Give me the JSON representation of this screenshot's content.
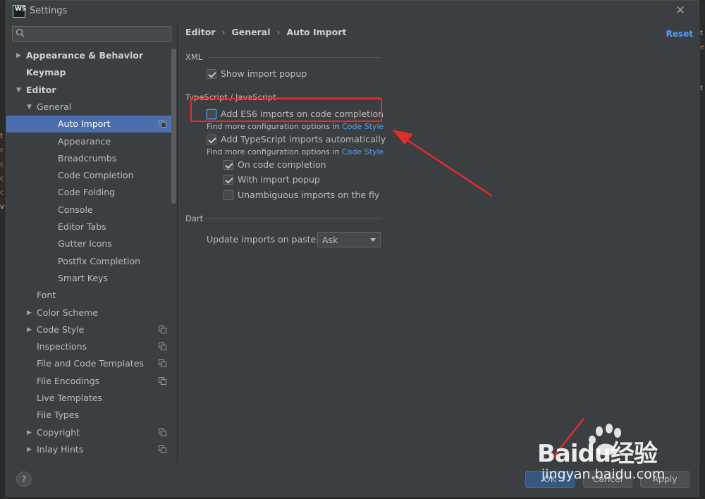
{
  "window": {
    "title": "Settings",
    "logo": "WS"
  },
  "search": {
    "placeholder": "",
    "value": ""
  },
  "tree": [
    {
      "label": "Appearance & Behavior",
      "level": 0,
      "bold": true,
      "arrow": "right"
    },
    {
      "label": "Keymap",
      "level": 0,
      "bold": true,
      "arrow": ""
    },
    {
      "label": "Editor",
      "level": 0,
      "bold": true,
      "arrow": "down"
    },
    {
      "label": "General",
      "level": 1,
      "bold": false,
      "arrow": "down"
    },
    {
      "label": "Auto Import",
      "level": 2,
      "bold": false,
      "arrow": "",
      "selected": true,
      "copy": true
    },
    {
      "label": "Appearance",
      "level": 2,
      "bold": false,
      "arrow": ""
    },
    {
      "label": "Breadcrumbs",
      "level": 2,
      "bold": false,
      "arrow": ""
    },
    {
      "label": "Code Completion",
      "level": 2,
      "bold": false,
      "arrow": ""
    },
    {
      "label": "Code Folding",
      "level": 2,
      "bold": false,
      "arrow": ""
    },
    {
      "label": "Console",
      "level": 2,
      "bold": false,
      "arrow": ""
    },
    {
      "label": "Editor Tabs",
      "level": 2,
      "bold": false,
      "arrow": ""
    },
    {
      "label": "Gutter Icons",
      "level": 2,
      "bold": false,
      "arrow": ""
    },
    {
      "label": "Postfix Completion",
      "level": 2,
      "bold": false,
      "arrow": ""
    },
    {
      "label": "Smart Keys",
      "level": 2,
      "bold": false,
      "arrow": ""
    },
    {
      "label": "Font",
      "level": 1,
      "bold": false,
      "arrow": ""
    },
    {
      "label": "Color Scheme",
      "level": 1,
      "bold": false,
      "arrow": "right"
    },
    {
      "label": "Code Style",
      "level": 1,
      "bold": false,
      "arrow": "right",
      "copy": true
    },
    {
      "label": "Inspections",
      "level": 1,
      "bold": false,
      "arrow": "",
      "copy": true
    },
    {
      "label": "File and Code Templates",
      "level": 1,
      "bold": false,
      "arrow": "",
      "copy": true
    },
    {
      "label": "File Encodings",
      "level": 1,
      "bold": false,
      "arrow": "",
      "copy": true
    },
    {
      "label": "Live Templates",
      "level": 1,
      "bold": false,
      "arrow": ""
    },
    {
      "label": "File Types",
      "level": 1,
      "bold": false,
      "arrow": ""
    },
    {
      "label": "Copyright",
      "level": 1,
      "bold": false,
      "arrow": "right",
      "copy": true
    },
    {
      "label": "Inlay Hints",
      "level": 1,
      "bold": false,
      "arrow": "right",
      "copy": true
    }
  ],
  "breadcrumb": [
    "Editor",
    "General",
    "Auto Import"
  ],
  "reset_label": "Reset",
  "sections": {
    "xml": {
      "title": "XML",
      "show_import_popup": {
        "label": "Show import popup",
        "checked": true
      }
    },
    "ts": {
      "title": "TypeScript / JavaScript",
      "es6": {
        "label": "Add ES6 imports on code completion",
        "checked": false
      },
      "hint1_prefix": "Find more configuration options in ",
      "hint1_link": "Code Style",
      "ts_auto": {
        "label": "Add TypeScript imports automatically",
        "checked": true
      },
      "hint2_prefix": "Find more configuration options in ",
      "hint2_link": "Code Style",
      "on_completion": {
        "label": "On code completion",
        "checked": true
      },
      "with_popup": {
        "label": "With import popup",
        "checked": true
      },
      "unambiguous": {
        "label": "Unambiguous imports on the fly",
        "checked": false
      }
    },
    "dart": {
      "title": "Dart",
      "update_label": "Update imports on paste:",
      "update_value": "Ask"
    }
  },
  "buttons": {
    "help": "?",
    "ok": "OK",
    "cancel": "Cancel",
    "apply": "Apply"
  },
  "watermark": {
    "text": "Baidu经验",
    "url": "jingyan.baidu.com"
  },
  "colors": {
    "accent": "#4b6eaf",
    "link": "#589df6",
    "annotation": "#e32b2b",
    "background": "#3c3f41"
  }
}
